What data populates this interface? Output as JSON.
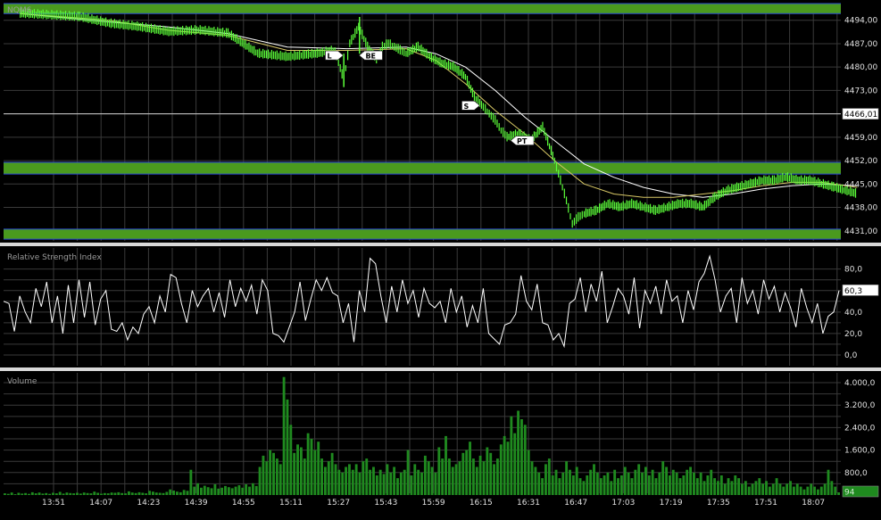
{
  "colors": {
    "background": "#000000",
    "grid": "#3a3a3a",
    "price": "#5cff3a",
    "band": "#4a9a1e",
    "band_edge": "#2b4bd1",
    "ma_white": "#ffffff",
    "ma_yellow": "#d8c866",
    "rsi": "#ffffff",
    "volume": "#1f8a1f",
    "label": "#e0e0e0",
    "separator": "#d8d8d8"
  },
  "chart_data": [
    {
      "id": "price",
      "type": "line",
      "title": "NQM6",
      "ylim": [
        4428,
        4499
      ],
      "y_ticks": [
        "4494,00",
        "4487,00",
        "4480,00",
        "4473,00",
        "4466,00",
        "4459,00",
        "4452,00",
        "4445,00",
        "4438,00",
        "4431,00"
      ],
      "y_tick_values": [
        4494,
        4487,
        4480,
        4473,
        4466,
        4459,
        4452,
        4445,
        4438,
        4431
      ],
      "current_value_label": "4466,01",
      "current_value": 4466.01,
      "bands": [
        {
          "from": 4496.0,
          "to": 4499.0
        },
        {
          "from": 4448.0,
          "to": 4451.5
        },
        {
          "from": 4428.5,
          "to": 4431.5
        }
      ],
      "x_ticks": [
        "13:51",
        "14:07",
        "14:23",
        "14:39",
        "14:55",
        "15:11",
        "15:27",
        "15:43",
        "15:59",
        "16:15",
        "16:31",
        "16:47",
        "17:03",
        "17:19",
        "17:35",
        "17:51",
        "18:07"
      ],
      "x_minutes": [
        0,
        16,
        32,
        48,
        64,
        80,
        96,
        112,
        128,
        144,
        160,
        176,
        192,
        208,
        224,
        240,
        256
      ],
      "price_series": {
        "t": [
          -10,
          0,
          10,
          20,
          30,
          40,
          50,
          60,
          70,
          80,
          90,
          96,
          99,
          101,
          104,
          107,
          110,
          112,
          114,
          116,
          118,
          120,
          124,
          128,
          132,
          136,
          140,
          143,
          146,
          148,
          150,
          152,
          154,
          158,
          162,
          166,
          170,
          172,
          174,
          176,
          178,
          180,
          184,
          188,
          192,
          196,
          200,
          204,
          208,
          212,
          216,
          220,
          224,
          228,
          232,
          236,
          240,
          244,
          248,
          252,
          256,
          260,
          264,
          268,
          272
        ],
        "y": [
          4496,
          4495.5,
          4495,
          4493,
          4492,
          4490.5,
          4491,
          4490,
          4484,
          4483,
          4484,
          4485,
          4476,
          4487,
          4492,
          4486,
          4482,
          4486,
          4487,
          4486,
          4485,
          4484,
          4486,
          4483,
          4481,
          4480,
          4477,
          4471,
          4468,
          4466,
          4464,
          4461,
          4459,
          4460,
          4458,
          4462,
          4452,
          4446,
          4440,
          4433,
          4435,
          4436,
          4437,
          4439,
          4438,
          4439,
          4438,
          4437,
          4438,
          4439,
          4439,
          4438,
          4441,
          4443,
          4444,
          4445,
          4446,
          4446,
          4447,
          4446,
          4446,
          4445,
          4444,
          4443,
          4442
        ]
      },
      "ma_white": {
        "t": [
          -10,
          20,
          40,
          60,
          80,
          100,
          120,
          130,
          140,
          150,
          160,
          170,
          180,
          190,
          200,
          210,
          220,
          230,
          240,
          250,
          260,
          272
        ],
        "y": [
          4496,
          4493.5,
          4492,
          4490,
          4486,
          4485.5,
          4486,
          4484,
          4480,
          4473,
          4465,
          4458,
          4451,
          4447,
          4444,
          4442,
          4441,
          4442,
          4443.5,
          4444.5,
          4445,
          4444.5
        ]
      },
      "ma_yellow": {
        "t": [
          -10,
          20,
          40,
          60,
          80,
          100,
          120,
          130,
          140,
          150,
          160,
          170,
          180,
          190,
          200,
          210,
          220,
          230,
          240,
          250,
          260,
          272
        ],
        "y": [
          4496,
          4494,
          4491,
          4489.5,
          4485,
          4485,
          4485.5,
          4482,
          4475,
          4467,
          4460,
          4452,
          4445,
          4442,
          4441,
          4441,
          4442,
          4443,
          4444.5,
          4445.5,
          4445.5,
          4444
        ]
      },
      "markers": [
        {
          "label": "L",
          "t": 97,
          "y": 4483.5,
          "dir": "right"
        },
        {
          "label": "BE",
          "t": 106,
          "y": 4483.5,
          "dir": "left"
        },
        {
          "label": "S",
          "t": 143,
          "y": 4468.5,
          "dir": "right"
        },
        {
          "label": "PT",
          "t": 157,
          "y": 4458,
          "dir": "left"
        }
      ]
    },
    {
      "id": "rsi",
      "type": "line",
      "title": "Relative Strength Index",
      "ylim": [
        -10,
        98
      ],
      "y_ticks": [
        "80,0",
        "60,0",
        "40,0",
        "20,0",
        "0,0"
      ],
      "y_tick_values": [
        80,
        60,
        40,
        20,
        0
      ],
      "current_value_label": "60,3",
      "current_value": 60.3,
      "values": [
        50,
        48,
        22,
        55,
        40,
        30,
        62,
        45,
        68,
        30,
        55,
        20,
        65,
        30,
        70,
        35,
        68,
        28,
        52,
        60,
        24,
        22,
        30,
        14,
        26,
        20,
        38,
        45,
        30,
        55,
        40,
        75,
        72,
        48,
        30,
        60,
        45,
        55,
        62,
        40,
        58,
        35,
        70,
        45,
        62,
        50,
        65,
        38,
        70,
        60,
        20,
        18,
        12,
        26,
        40,
        68,
        32,
        52,
        70,
        60,
        72,
        58,
        55,
        30,
        48,
        12,
        60,
        40,
        90,
        85,
        55,
        30,
        64,
        40,
        70,
        48,
        60,
        35,
        62,
        48,
        44,
        50,
        30,
        62,
        40,
        55,
        26,
        46,
        30,
        62,
        20,
        15,
        10,
        28,
        30,
        38,
        74,
        50,
        42,
        66,
        30,
        28,
        14,
        20,
        8,
        48,
        52,
        72,
        40,
        66,
        50,
        78,
        30,
        45,
        62,
        55,
        38,
        72,
        25,
        60,
        48,
        64,
        38,
        70,
        50,
        55,
        30,
        60,
        42,
        68,
        76,
        92,
        70,
        40,
        55,
        62,
        30,
        72,
        48,
        60,
        38,
        70,
        52,
        64,
        40,
        58,
        44,
        26,
        62,
        44,
        30,
        48,
        20,
        36,
        40,
        60
      ]
    },
    {
      "id": "volume",
      "type": "bar",
      "title": "Volume",
      "ylim": [
        0,
        4350
      ],
      "y_ticks": [
        "4.000,0",
        "3.200,0",
        "2.400,0",
        "1.600,0",
        "800,0"
      ],
      "y_tick_values": [
        4000,
        3200,
        2400,
        1600,
        800
      ],
      "current_value_label": "94",
      "current_value": 94,
      "values": [
        60,
        40,
        90,
        30,
        80,
        50,
        70,
        40,
        100,
        60,
        90,
        50,
        70,
        40,
        80,
        60,
        110,
        50,
        90,
        70,
        60,
        80,
        50,
        90,
        70,
        60,
        120,
        80,
        50,
        70,
        60,
        90,
        80,
        100,
        70,
        60,
        130,
        90,
        70,
        100,
        80,
        60,
        150,
        120,
        90,
        80,
        70,
        110,
        200,
        160,
        120,
        100,
        180,
        150,
        900,
        300,
        420,
        260,
        330,
        280,
        240,
        380,
        230,
        260,
        320,
        280,
        240,
        300,
        350,
        260,
        380,
        300,
        420,
        320,
        1000,
        1400,
        1200,
        1600,
        1500,
        1300,
        1100,
        4200,
        3400,
        2500,
        1500,
        1800,
        1700,
        1300,
        2200,
        2000,
        1600,
        1900,
        1300,
        1000,
        1200,
        1500,
        1100,
        900,
        800,
        1000,
        1100,
        900,
        1100,
        800,
        1200,
        1300,
        900,
        1000,
        700,
        900,
        750,
        1100,
        800,
        1000,
        600,
        800,
        900,
        1600,
        700,
        1100,
        900,
        800,
        1400,
        1200,
        1000,
        800,
        1700,
        1300,
        2100,
        1300,
        1000,
        1100,
        1200,
        1500,
        1600,
        1900,
        1300,
        1000,
        1400,
        1200,
        1700,
        1500,
        1100,
        1300,
        1800,
        2100,
        1900,
        2800,
        2200,
        3000,
        2700,
        2500,
        1600,
        1200,
        1000,
        800,
        600,
        1100,
        1300,
        700,
        900,
        600,
        800,
        1200,
        900,
        700,
        1000,
        600,
        500,
        700,
        900,
        1100,
        800,
        600,
        700,
        800,
        500,
        900,
        600,
        700,
        1000,
        800,
        600,
        900,
        1100,
        800,
        1000,
        700,
        900,
        600,
        800,
        1200,
        1000,
        700,
        900,
        800,
        600,
        700,
        900,
        1000,
        800,
        600,
        800,
        500,
        700,
        900,
        600,
        500,
        700,
        400,
        600,
        500,
        700,
        600,
        400,
        500,
        300,
        400,
        500,
        600,
        400,
        500,
        300,
        400,
        600,
        400,
        300,
        400,
        500,
        300,
        400,
        300,
        200,
        300,
        400,
        300,
        200,
        300,
        400,
        900,
        500,
        300,
        94
      ]
    }
  ]
}
